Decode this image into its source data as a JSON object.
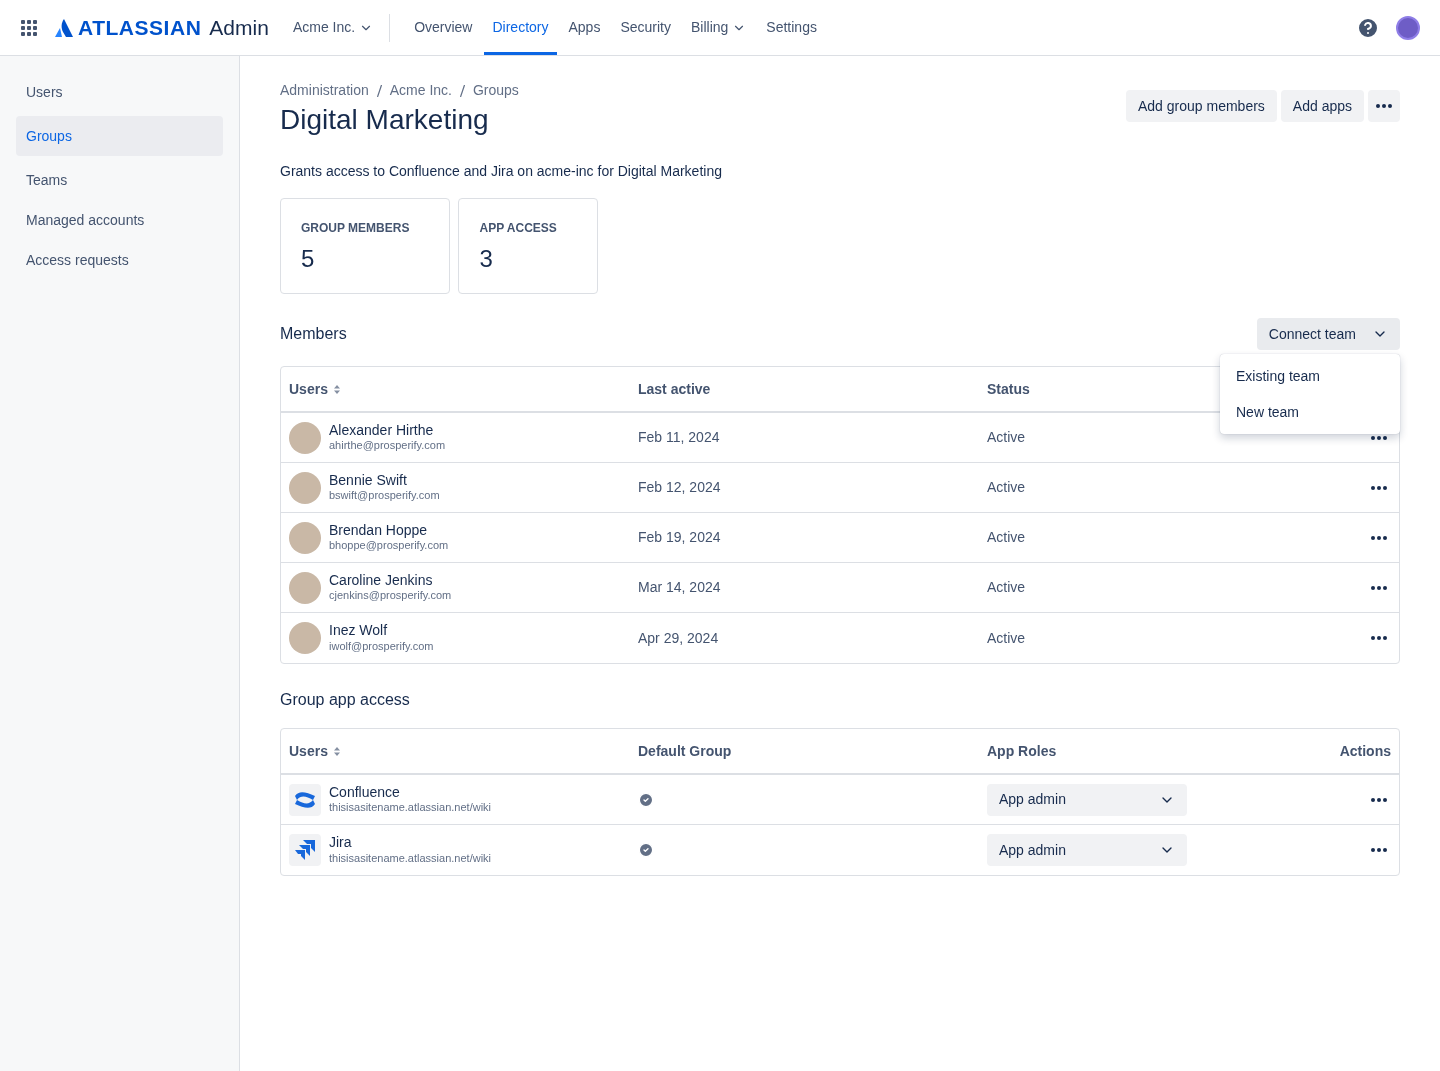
{
  "header": {
    "brand": "ATLASSIAN",
    "product": "Admin",
    "org": "Acme Inc.",
    "nav": [
      {
        "label": "Overview",
        "selected": false,
        "dropdown": false
      },
      {
        "label": "Directory",
        "selected": true,
        "dropdown": false
      },
      {
        "label": "Apps",
        "selected": false,
        "dropdown": false
      },
      {
        "label": "Security",
        "selected": false,
        "dropdown": false
      },
      {
        "label": "Billing",
        "selected": false,
        "dropdown": true
      },
      {
        "label": "Settings",
        "selected": false,
        "dropdown": false
      }
    ]
  },
  "sidebar": {
    "items": [
      {
        "label": "Users",
        "selected": false
      },
      {
        "label": "Groups",
        "selected": true
      },
      {
        "label": "Teams",
        "selected": false
      },
      {
        "label": "Managed accounts",
        "selected": false
      },
      {
        "label": "Access requests",
        "selected": false
      }
    ]
  },
  "breadcrumbs": [
    "Administration",
    "Acme Inc.",
    "Groups"
  ],
  "title": "Digital Marketing",
  "actions": [
    "Add group members",
    "Add apps"
  ],
  "description": "Grants access to Confluence and Jira on acme-inc for Digital Marketing",
  "stats": [
    {
      "label": "GROUP MEMBERS",
      "value": "5"
    },
    {
      "label": "APP ACCESS",
      "value": "3"
    }
  ],
  "members": {
    "title": "Members",
    "connect": {
      "label": "Connect team",
      "expanded": true,
      "options": [
        "Existing team",
        "New team"
      ]
    },
    "columns": [
      "Users",
      "Last active",
      "Status"
    ],
    "rows": [
      {
        "name": "Alexander Hirthe",
        "email": "ahirthe@prosperify.com",
        "last_active": "Feb 11, 2024",
        "status": "Active"
      },
      {
        "name": "Bennie Swift",
        "email": "bswift@prosperify.com",
        "last_active": "Feb 12, 2024",
        "status": "Active"
      },
      {
        "name": "Brendan Hoppe",
        "email": "bhoppe@prosperify.com",
        "last_active": "Feb 19, 2024",
        "status": "Active"
      },
      {
        "name": "Caroline Jenkins",
        "email": "cjenkins@prosperify.com",
        "last_active": "Mar 14, 2024",
        "status": "Active"
      },
      {
        "name": "Inez Wolf",
        "email": "iwolf@prosperify.com",
        "last_active": "Apr 29, 2024",
        "status": "Active"
      }
    ]
  },
  "app_access": {
    "title": "Group app access",
    "columns": [
      "Users",
      "Default Group",
      "App Roles",
      "Actions"
    ],
    "rows": [
      {
        "kind": "confluence",
        "name": "Confluence",
        "url": "thisisasitename.atlassian.net/wiki",
        "default": true,
        "role": "App admin"
      },
      {
        "kind": "jira",
        "name": "Jira",
        "url": "thisisasitename.atlassian.net/wiki",
        "default": true,
        "role": "App admin"
      }
    ]
  }
}
